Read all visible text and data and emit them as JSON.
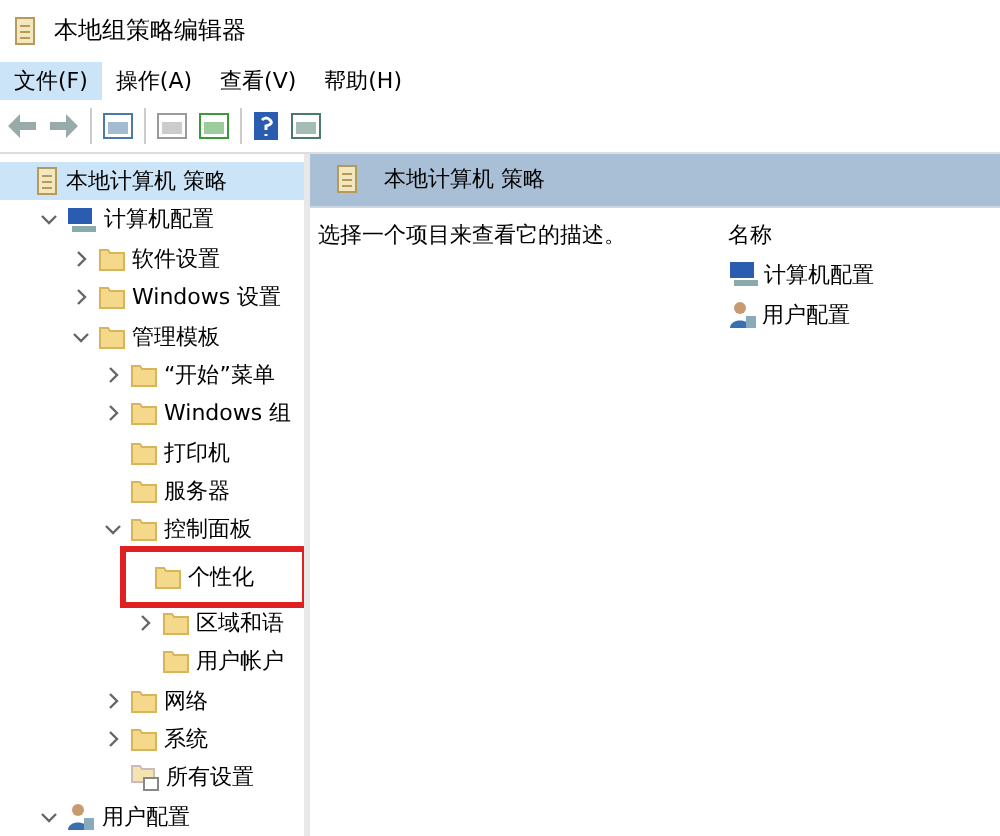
{
  "window": {
    "title": "本地组策略编辑器"
  },
  "menu": [
    {
      "label": "文件(F)",
      "selected": true
    },
    {
      "label": "操作(A)",
      "selected": false
    },
    {
      "label": "查看(V)",
      "selected": false
    },
    {
      "label": "帮助(H)",
      "selected": false
    }
  ],
  "tree": [
    {
      "label": "本地计算机 策略",
      "kind": "policy",
      "selected": true,
      "annotated": false,
      "children": [
        {
          "label": "计算机配置",
          "kind": "computer",
          "selected": false,
          "expanded": true,
          "annotated": false,
          "children": [
            {
              "label": "软件设置",
              "kind": "folder",
              "selected": false,
              "expanded": false,
              "annotated": false
            },
            {
              "label": "Windows 设置",
              "kind": "folder",
              "selected": false,
              "expanded": false,
              "annotated": false
            },
            {
              "label": "管理模板",
              "kind": "folder",
              "selected": false,
              "expanded": true,
              "annotated": false,
              "children": [
                {
                  "label": "“开始”菜单",
                  "kind": "folder",
                  "selected": false,
                  "expanded": false,
                  "annotated": false
                },
                {
                  "label": "Windows 组",
                  "kind": "folder",
                  "selected": false,
                  "expanded": false,
                  "annotated": false
                },
                {
                  "label": "打印机",
                  "kind": "folder",
                  "selected": false,
                  "annotated": false
                },
                {
                  "label": "服务器",
                  "kind": "folder",
                  "selected": false,
                  "annotated": false
                },
                {
                  "label": "控制面板",
                  "kind": "folder",
                  "selected": false,
                  "expanded": true,
                  "annotated": false,
                  "children": [
                    {
                      "label": "个性化",
                      "kind": "folder",
                      "selected": false,
                      "annotated": true
                    },
                    {
                      "label": "区域和语",
                      "kind": "folder",
                      "selected": false,
                      "expanded": false,
                      "annotated": false
                    },
                    {
                      "label": "用户帐户",
                      "kind": "folder",
                      "selected": false,
                      "annotated": false
                    }
                  ]
                },
                {
                  "label": "网络",
                  "kind": "folder",
                  "selected": false,
                  "expanded": false,
                  "annotated": false
                },
                {
                  "label": "系统",
                  "kind": "folder",
                  "selected": false,
                  "expanded": false,
                  "annotated": false
                },
                {
                  "label": "所有设置",
                  "kind": "settings",
                  "selected": false,
                  "annotated": false
                }
              ]
            }
          ]
        },
        {
          "label": "用户配置",
          "kind": "user",
          "selected": false,
          "expanded": true,
          "annotated": false
        }
      ]
    }
  ],
  "detail": {
    "title": "本地计算机 策略",
    "description": "选择一个项目来查看它的描述。",
    "column": "名称",
    "items": [
      {
        "label": "计算机配置",
        "kind": "computer"
      },
      {
        "label": "用户配置",
        "kind": "user"
      }
    ]
  }
}
